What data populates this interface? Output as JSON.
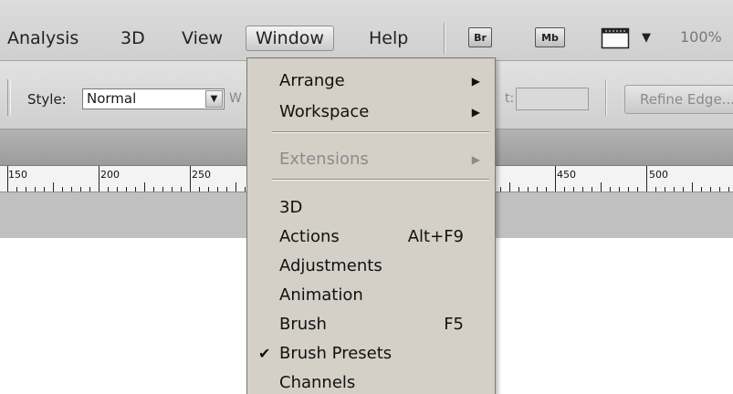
{
  "menubar": {
    "items": [
      "Analysis",
      "3D",
      "View",
      "Window",
      "Help"
    ],
    "bridge_label": "Br",
    "minibridge_label": "Mb",
    "zoom": "100%"
  },
  "options": {
    "style_label": "Style:",
    "style_value": "Normal",
    "width_clip": "W",
    "height_clip": "t:",
    "refine_edge": "Refine Edge..."
  },
  "ruler": {
    "labels": [
      "150",
      "200",
      "250",
      "450",
      "500"
    ]
  },
  "window_menu": {
    "arrange": "Arrange",
    "workspace": "Workspace",
    "extensions": "Extensions",
    "threed": "3D",
    "actions": "Actions",
    "actions_shortcut": "Alt+F9",
    "adjustments": "Adjustments",
    "animation": "Animation",
    "brush": "Brush",
    "brush_shortcut": "F5",
    "brush_presets": "Brush Presets",
    "channels": "Channels"
  },
  "icons": {
    "submenu": "submenu-arrow-icon",
    "checkmark": "checkmark-icon",
    "dropdown": "chevron-down-icon",
    "screen_mode": "screen-mode-icon"
  }
}
